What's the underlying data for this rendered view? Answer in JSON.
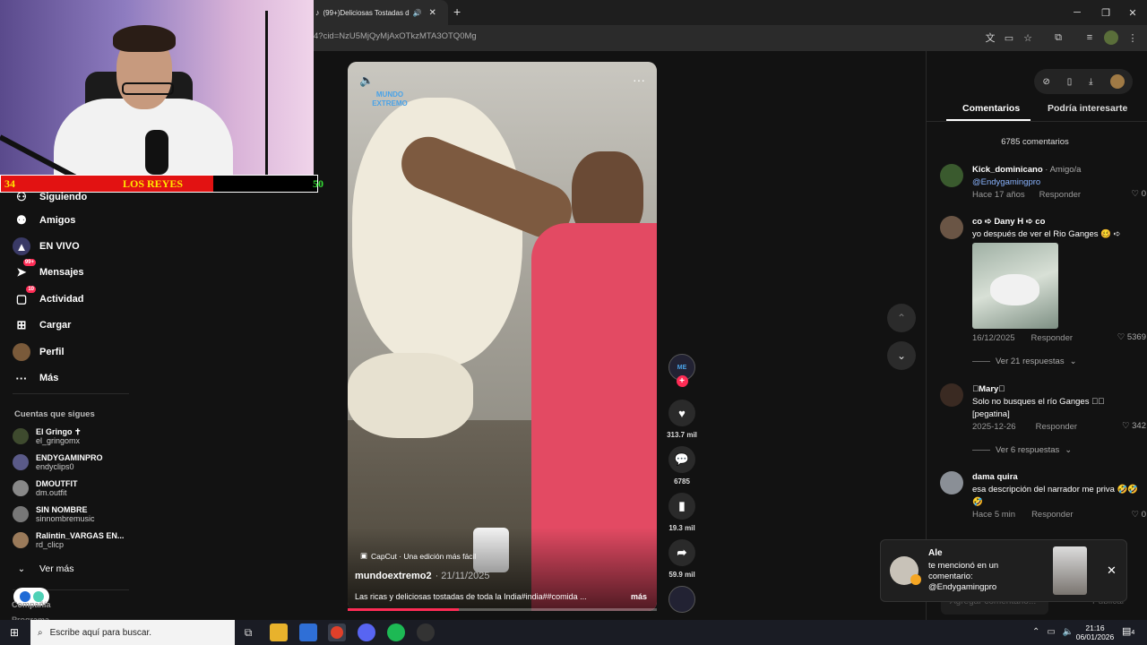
{
  "browser": {
    "tab_title": "(99+)Deliciosas Tostadas de",
    "new_tab": "+",
    "url": "4?cid=NzU5MjQyMjAxOTkzMTA3OTQ0Mg",
    "window": {
      "minimize": "─",
      "restore": "❐",
      "close": "✕"
    }
  },
  "stream_overlay": {
    "left_score": "34",
    "team": "LOS REYES",
    "right_score": "50"
  },
  "sidebar": {
    "nav": [
      {
        "label": "Siguiendo",
        "icon": "following-icon"
      },
      {
        "label": "Amigos",
        "icon": "friends-icon"
      },
      {
        "label": "EN VIVO",
        "icon": "live-icon"
      },
      {
        "label": "Mensajes",
        "icon": "messages-icon",
        "badge": "99+"
      },
      {
        "label": "Actividad",
        "icon": "activity-icon",
        "badge": "10"
      },
      {
        "label": "Cargar",
        "icon": "upload-icon"
      },
      {
        "label": "Perfil",
        "icon": "profile-icon"
      },
      {
        "label": "Más",
        "icon": "more-icon"
      }
    ],
    "following_title": "Cuentas que sigues",
    "following": [
      {
        "name": "El Gringo ✝",
        "handle": "el_gringomx"
      },
      {
        "name": "ENDYGAMINPRO",
        "handle": "endyclips0"
      },
      {
        "name": "DMOUTFIT",
        "handle": "dm.outfit"
      },
      {
        "name": "SIN NOMBRE",
        "handle": "sinnombremusic"
      },
      {
        "name": "Ralintin_VARGAS EN...",
        "handle": "rd_clicp"
      }
    ],
    "see_more": "Ver más",
    "footer_company": "Compañía",
    "footer_program": "Programa"
  },
  "video": {
    "capcut": "CapCut · Una edición más fácil",
    "author": "mundoextremo2",
    "date": "· 21/11/2025",
    "caption": "Las ricas y deliciosas tostadas de toda la India#india##comida ...",
    "more": "más",
    "watermark": "MUNDO EXTREMO",
    "progress": 0.36
  },
  "actions": {
    "likes": "313.7 mil",
    "comments": "6785",
    "saves": "19.3 mil",
    "shares": "59.9 mil"
  },
  "comments_panel": {
    "tab_comments": "Comentarios",
    "tab_interest": "Podría interesarte",
    "count": "6785 comentarios",
    "items": [
      {
        "name": "Kick_dominicano",
        "suffix": " · Amigo/a",
        "text": "@Endygamingpro",
        "time": "Hace 17 años",
        "reply": "Responder",
        "likes": "0"
      },
      {
        "name": "co ➪ Dany H ➪ co",
        "suffix": "",
        "text": "yo después de ver el Rio Ganges 🥴 ➪",
        "time": "16/12/2025",
        "reply": "Responder",
        "likes": "5369",
        "replies": "Ver 21 respuestas"
      },
      {
        "name": "\u0000Mary\u0000",
        "suffix": "",
        "text": "Solo no busques el río Ganges \u0000\u0000 [pegatina]",
        "time": "2025-12-26",
        "reply": "Responder",
        "likes": "342",
        "replies": "Ver 6 respuestas"
      },
      {
        "name": "dama quira",
        "suffix": "",
        "text": "esa descripción del narrador me priva 🤣🤣🤣",
        "time": "Hace 5 min",
        "reply": "Responder",
        "likes": "0"
      }
    ],
    "input_placeholder": "Agregar comentario...",
    "publish": "Publicar"
  },
  "notification": {
    "name": "Ale",
    "text": "te mencionó en un comentario: @Endygamingpro"
  },
  "taskbar": {
    "search_placeholder": "Escribe aquí para buscar.",
    "time": "21:16",
    "date": "06/01/2026",
    "notif_count": "4"
  }
}
